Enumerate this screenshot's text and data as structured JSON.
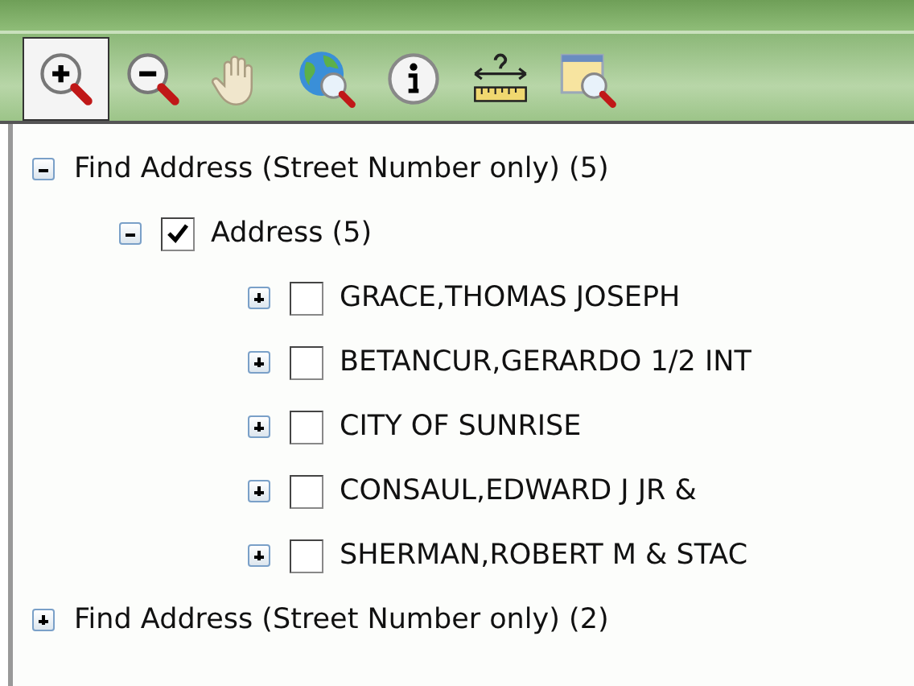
{
  "toolbar": {
    "tools": [
      {
        "kind": "zoom-in",
        "selected": true
      },
      {
        "kind": "zoom-out",
        "selected": false
      },
      {
        "kind": "pan",
        "selected": false
      },
      {
        "kind": "globe",
        "selected": false
      },
      {
        "kind": "info",
        "selected": false
      },
      {
        "kind": "measure",
        "selected": false
      },
      {
        "kind": "window-zoom",
        "selected": false
      }
    ]
  },
  "tree": [
    {
      "label": "Find Address (Street Number only) (5)",
      "expanded": true,
      "children": [
        {
          "label": "Address (5)",
          "expanded": true,
          "checked": true,
          "children": [
            {
              "label": "GRACE,THOMAS JOSEPH",
              "expanded": false,
              "checked": false
            },
            {
              "label": "BETANCUR,GERARDO 1/2 INT",
              "expanded": false,
              "checked": false
            },
            {
              "label": "CITY OF SUNRISE",
              "expanded": false,
              "checked": false
            },
            {
              "label": "CONSAUL,EDWARD J JR &",
              "expanded": false,
              "checked": false
            },
            {
              "label": "SHERMAN,ROBERT M & STAC",
              "expanded": false,
              "checked": false
            }
          ]
        }
      ]
    },
    {
      "label": "Find Address (Street Number only) (2)",
      "expanded": false
    }
  ]
}
